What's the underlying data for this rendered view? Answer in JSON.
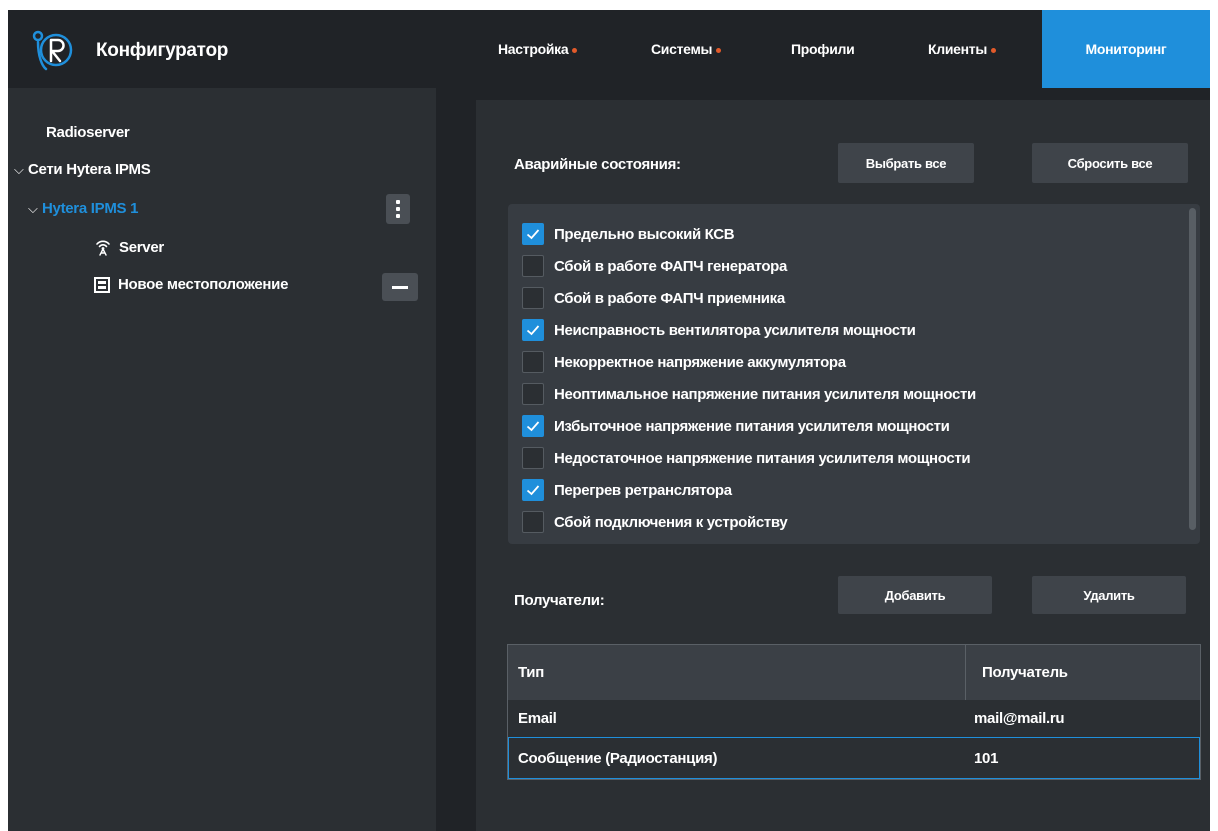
{
  "app": {
    "title": "Конфигуратор",
    "accent_color": "#1f8fdb",
    "dot_color": "#e25a2a"
  },
  "nav": {
    "items": [
      {
        "label": "Настройка",
        "has_dot": true
      },
      {
        "label": "Системы",
        "has_dot": true
      },
      {
        "label": "Профили",
        "has_dot": false
      },
      {
        "label": "Клиенты",
        "has_dot": true
      },
      {
        "label": "Мониторинг",
        "active": true
      }
    ]
  },
  "sidebar": {
    "root": "Radioserver",
    "networks": "Сети Hytera IPMS",
    "system": "Hytera IPMS 1",
    "server": "Server",
    "location": "Новое местоположение",
    "icons": [
      "chevron-down-icon",
      "kebab-menu-icon",
      "antenna-icon",
      "location-icon",
      "minus-icon"
    ]
  },
  "alarms": {
    "label": "Аварийные состояния:",
    "select_all": "Выбрать все",
    "reset_all": "Сбросить все",
    "items": [
      {
        "label": "Предельно высокий КСВ",
        "checked": true
      },
      {
        "label": "Сбой в работе ФАПЧ генератора",
        "checked": false
      },
      {
        "label": "Сбой в работе ФАПЧ приемника",
        "checked": false
      },
      {
        "label": "Неисправность вентилятора усилителя мощности",
        "checked": true
      },
      {
        "label": "Некорректное напряжение аккумулятора",
        "checked": false
      },
      {
        "label": "Неоптимальное напряжение питания усилителя мощности",
        "checked": false
      },
      {
        "label": "Избыточное напряжение питания усилителя мощности",
        "checked": true
      },
      {
        "label": "Недостаточное напряжение питания усилителя мощности",
        "checked": false
      },
      {
        "label": "Перегрев ретранслятора",
        "checked": true
      },
      {
        "label": "Сбой подключения к устройству",
        "checked": false
      }
    ]
  },
  "recipients": {
    "label": "Получатели:",
    "add": "Добавить",
    "remove": "Удалить",
    "columns": [
      "Тип",
      "Получатель"
    ],
    "rows": [
      [
        "Email",
        "mail@mail.ru"
      ],
      [
        "Сообщение (Радиостанция)",
        "101"
      ]
    ]
  }
}
